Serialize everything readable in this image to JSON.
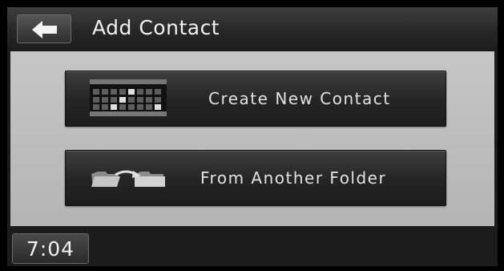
{
  "header": {
    "title": "Add Contact"
  },
  "options": [
    {
      "label": "Create New Contact",
      "icon": "keypad-icon"
    },
    {
      "label": "From Another Folder",
      "icon": "folder-transfer-icon"
    }
  ],
  "status": {
    "time": "7:04"
  }
}
